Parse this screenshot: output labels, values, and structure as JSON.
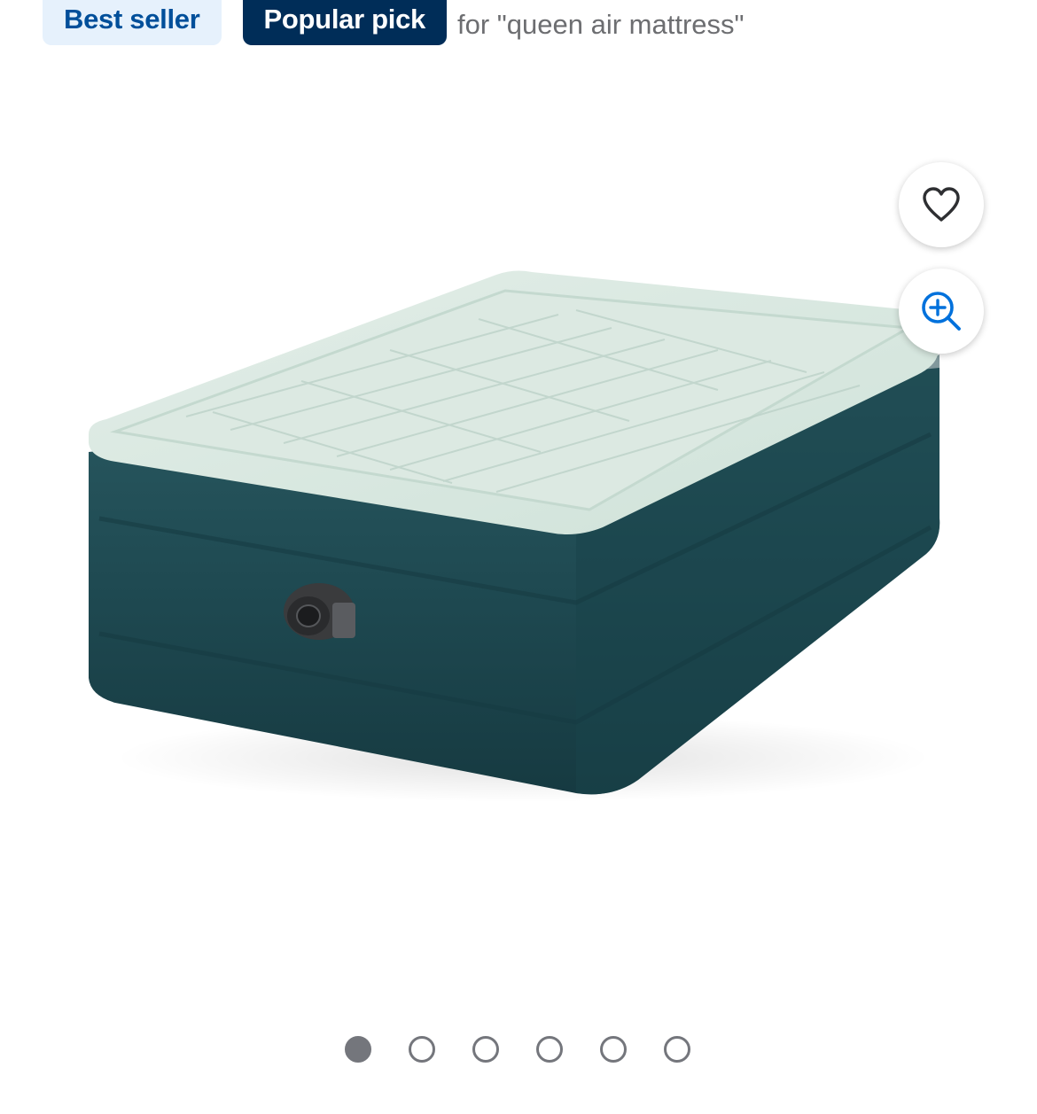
{
  "badges": {
    "best_seller": "Best seller",
    "popular_pick": "Popular pick",
    "popular_context": "for \"queen air mattress\""
  },
  "image": {
    "subject": "air-mattress",
    "colors": {
      "top": "#d6e6dd",
      "side": "#1f4a52",
      "pump": "#3a3b3d"
    }
  },
  "actions": {
    "favorite_icon": "heart-icon",
    "zoom_icon": "zoom-in-icon",
    "zoom_color": "#0071dc"
  },
  "carousel": {
    "dots": [
      {
        "state": "active"
      },
      {
        "state": "inactive"
      },
      {
        "state": "inactive"
      },
      {
        "state": "inactive"
      },
      {
        "state": "inactive"
      },
      {
        "state": "inactive"
      }
    ],
    "active_index": 0,
    "total": 6
  }
}
